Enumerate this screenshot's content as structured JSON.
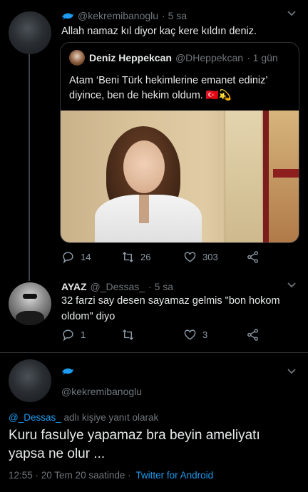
{
  "tweet1": {
    "handle": "@kekremibanoglu",
    "time": "· 5 sa",
    "text": "Allah namaz kıl diyor kaç kere kıldın deniz.",
    "quote": {
      "name": "Deniz Heppekcan",
      "handle": "@DHeppekcan",
      "time": "· 1 gün",
      "text": "Atam ‘Beni Türk hekimlerine emanet ediniz’ diyince, ben de hekim oldum. 🇹🇷💫"
    },
    "actions": {
      "replies": "14",
      "retweets": "26",
      "likes": "303"
    }
  },
  "tweet2": {
    "name": "AYAZ",
    "handle": "@_Dessas_",
    "time": "· 5 sa",
    "text": "32 farzi say desen sayamaz gelmis \"bon hokom oldom\" diyo",
    "actions": {
      "replies": "1",
      "retweets": "",
      "likes": "3"
    }
  },
  "main": {
    "handle": "@kekremibanoglu",
    "reply_to_user": "@_Dessas_",
    "reply_to_suffix": " adlı kişiye yanıt olarak",
    "text": "Kuru fasulye yapamaz bra beyin ameliyatı yapsa ne olur ...",
    "time": "12:55 · 20 Tem 20 saatinde ·",
    "client": "Twitter for Android"
  },
  "colors": {
    "accent": "#1d9bf0",
    "bg": "#000000",
    "muted": "#71767b"
  }
}
